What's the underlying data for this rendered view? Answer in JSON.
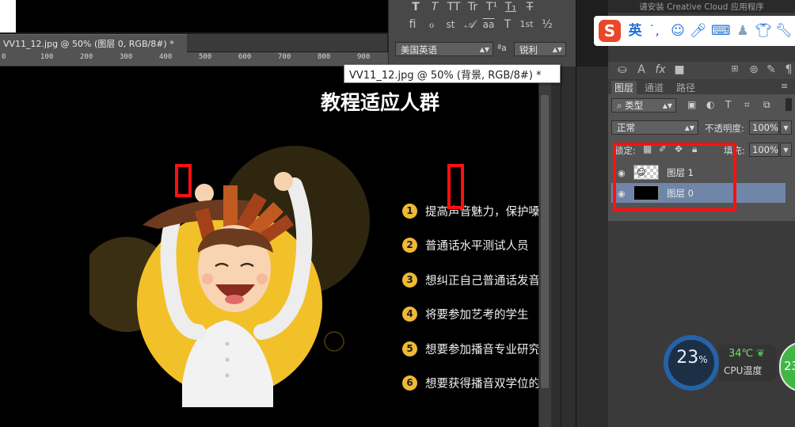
{
  "document": {
    "tab_label": "VV11_12.jpg @ 50% (图层 0, RGB/8#) *",
    "ruler_marks": [
      "0",
      "100",
      "200",
      "300",
      "400",
      "500",
      "600",
      "700",
      "800",
      "900"
    ]
  },
  "tooltip": {
    "label": "VV11_12.jpg @ 50% (背景, RGB/8#) *"
  },
  "canvas": {
    "title": "教程适应人群",
    "items": [
      {
        "num": "1",
        "text": "提高声音魅力，保护嗓"
      },
      {
        "num": "2",
        "text": "普通话水平测试人员"
      },
      {
        "num": "3",
        "text": "想纠正自己普通话发音"
      },
      {
        "num": "4",
        "text": "将要参加艺考的学生"
      },
      {
        "num": "5",
        "text": "想要参加播音专业研究"
      },
      {
        "num": "6",
        "text": "想要获得播音双学位的"
      }
    ]
  },
  "character_panel": {
    "style_glyphs": [
      "T",
      "T",
      "TT",
      "Tr",
      "T¹",
      "T₁",
      "T"
    ],
    "opentype_glyphs": [
      "ﬁ",
      "ℴ",
      "st",
      "𝒜",
      "aa",
      "T",
      "1st",
      "½"
    ],
    "language": "美国英语",
    "aa_icon": "ªa",
    "antialias": "锐利"
  },
  "cc_bar": {
    "text": "请安装 Creative Cloud 应用程序"
  },
  "ime": {
    "logo": "S",
    "mode": "英",
    "icons": [
      "punctuation-icon",
      "emoji-icon",
      "microphone-icon",
      "keyboard-icon",
      "user-icon",
      "skin-icon",
      "settings-icon"
    ]
  },
  "layers_panel": {
    "tabs": [
      "图层",
      "通道",
      "路径"
    ],
    "active_tab": "图层",
    "filter_type": "类型",
    "blend_mode": "正常",
    "opacity_label": "不透明度:",
    "opacity_value": "100%",
    "lock_label": "锁定:",
    "fill_label": "填充:",
    "fill_value": "100%",
    "layers": [
      {
        "name": "图层 1",
        "selected": false
      },
      {
        "name": "图层 0",
        "selected": true
      }
    ]
  },
  "cpu_widget": {
    "usage": "23",
    "usage_unit": "%",
    "temperature": "34℃",
    "label": "CPU温度",
    "next_badge": "23"
  },
  "colors": {
    "accent_yellow": "#f0b935",
    "highlight_red": "#ff1010",
    "selected_layer": "#6f86a8"
  }
}
